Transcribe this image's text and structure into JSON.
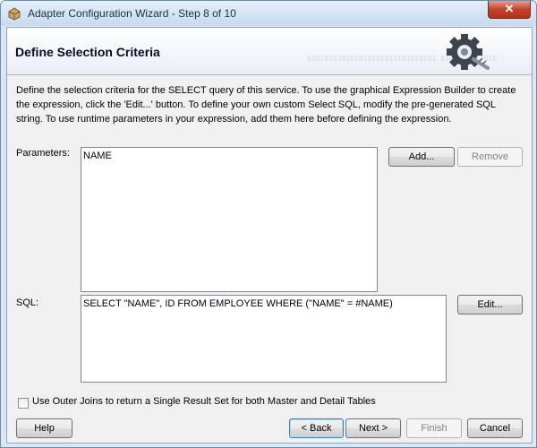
{
  "window": {
    "title": "Adapter Configuration Wizard - Step 8 of 10",
    "close_glyph": "✕"
  },
  "header": {
    "title": "Define Selection Criteria",
    "binary_text": "010101010101010101010101010101 0101010101010"
  },
  "intro_text": "Define the selection criteria for the SELECT query of this service.  To use the graphical Expression Builder to create the expression, click the 'Edit...' button.  To define your own custom Select SQL, modify the pre-generated SQL string.  To use runtime parameters in your expression, add them here before defining the expression.",
  "parameters": {
    "label": "Parameters:",
    "items": [
      "NAME"
    ],
    "add_label": "Add...",
    "remove_label": "Remove"
  },
  "sql": {
    "label": "SQL:",
    "value": "SELECT \"NAME\", ID FROM EMPLOYEE WHERE (\"NAME\" = #NAME)",
    "edit_label": "Edit..."
  },
  "outer_joins": {
    "label": "Use Outer Joins to return a Single Result Set for both Master and Detail Tables",
    "checked": false
  },
  "footer": {
    "help_label": "Help",
    "back_label": "< Back",
    "next_label": "Next >",
    "finish_label": "Finish",
    "cancel_label": "Cancel"
  },
  "colors": {
    "title_bar": "#c8daef",
    "close_button": "#c2432a",
    "client_bg": "#f0f0f0"
  }
}
